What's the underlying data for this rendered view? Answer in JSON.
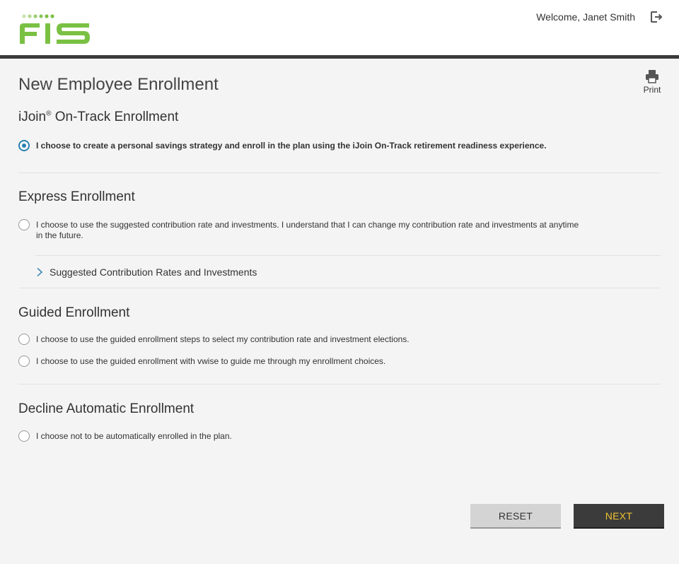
{
  "header": {
    "logo_text": "FIS",
    "welcome": "Welcome, Janet Smith"
  },
  "page": {
    "title": "New Employee Enrollment",
    "print_label": "Print"
  },
  "sections": {
    "ijoin": {
      "title_main": "iJoin",
      "title_sup": "®",
      "title_rest": " On-Track Enrollment",
      "option": "I choose to create a personal savings strategy and enroll in the plan using the iJoin On-Track retirement readiness experience."
    },
    "express": {
      "title": "Express Enrollment",
      "option_line1": "I choose to use the suggested contribution rate and investments. I understand that I can change my contribution rate and investments at anytime",
      "option_line2": "in the future.",
      "expander": "Suggested Contribution Rates and Investments"
    },
    "guided": {
      "title": "Guided Enrollment",
      "option1": "I choose to use the guided enrollment steps to select my contribution rate and investment elections.",
      "option2": "I choose to use the guided enrollment with vwise to guide me through my enrollment choices."
    },
    "decline": {
      "title": "Decline Automatic Enrollment",
      "option": "I choose not to be automatically enrolled in the plan."
    }
  },
  "selected_option": "ijoin",
  "buttons": {
    "reset": "RESET",
    "next": "NEXT"
  },
  "colors": {
    "brand_green": "#7ac143",
    "radio_selected": "#2a7fb0",
    "next_text": "#f1c232",
    "header_bar": "#3b3b3b"
  },
  "icons": {
    "logout": "logout-icon",
    "print": "printer-icon",
    "expander": "chevron-right-icon"
  }
}
